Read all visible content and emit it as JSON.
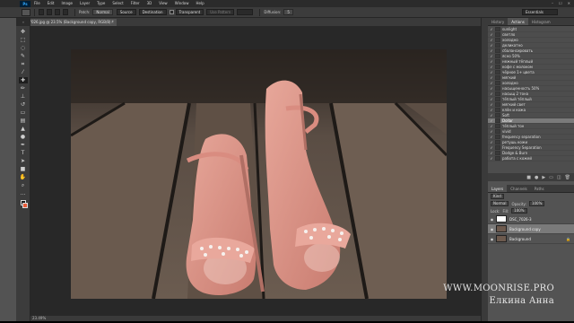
{
  "app": {
    "logo": "Ps",
    "menus": [
      "File",
      "Edit",
      "Image",
      "Layer",
      "Type",
      "Select",
      "Filter",
      "3D",
      "View",
      "Window",
      "Help"
    ],
    "window_controls": [
      "–",
      "☐",
      "✕"
    ]
  },
  "options": {
    "patch_label": "Patch:",
    "patch_mode": "Normal",
    "source_label": "Source",
    "destination_label": "Destination",
    "transparent_label": "Transparent",
    "use_pattern_label": "Use Pattern",
    "diffusion_label": "Diffusion:",
    "diffusion_value": "5",
    "workspace": "Essentials"
  },
  "document": {
    "tab_title": "DSC_7026.jpg @ 23.5% (Background copy, RGB/8) *",
    "zoom_status": "23.49%"
  },
  "tools": [
    "move",
    "marquee",
    "lasso",
    "quick-select",
    "crop",
    "eyedropper",
    "healing",
    "brush",
    "stamp",
    "history-brush",
    "eraser",
    "gradient",
    "blur",
    "dodge",
    "pen",
    "type",
    "path-select",
    "shape",
    "hand",
    "zoom"
  ],
  "history": {
    "tabs": [
      "History",
      "Actions",
      "Histogram"
    ],
    "active_tab": "Actions",
    "items": [
      "sunlight",
      "светло",
      "холодно",
      "деликатно",
      "сбалансировать",
      "ясно 50%",
      "нежный тёплый",
      "кофе с молоком",
      "чёрное 1+ цвета",
      "мягкий",
      "холодно",
      "насыщенность 50%",
      "насыщ 2 тона",
      "тёплый тёплый",
      "мягкий свет",
      "клён и кожа",
      "Soft",
      "Dollar",
      "тёплый тон",
      "vivid",
      "frequency separation",
      "ретушь кожи",
      "Frequency Separation",
      "Dodge & Burn",
      "работа с кожей"
    ],
    "selected_index": 17,
    "footer_icons": [
      "stop-icon",
      "record-icon",
      "play-icon",
      "folder-icon",
      "new-icon",
      "trash-icon"
    ]
  },
  "layers": {
    "tabs": [
      "Layers",
      "Channels",
      "Paths"
    ],
    "kind_label": "Kind",
    "blend_mode": "Normal",
    "opacity_label": "Opacity:",
    "opacity_value": "100%",
    "lock_label": "Lock:",
    "fill_label": "Fill:",
    "fill_value": "100%",
    "rows": [
      {
        "name": "DSC_7026-3",
        "selected": false,
        "blank": true
      },
      {
        "name": "Background copy",
        "selected": true,
        "blank": false
      },
      {
        "name": "Background",
        "selected": false,
        "blank": false,
        "lock": "🔒"
      }
    ]
  },
  "watermark": {
    "line1": "WWW.MOONRISE.PRO",
    "line2": "Елкина Анна"
  }
}
